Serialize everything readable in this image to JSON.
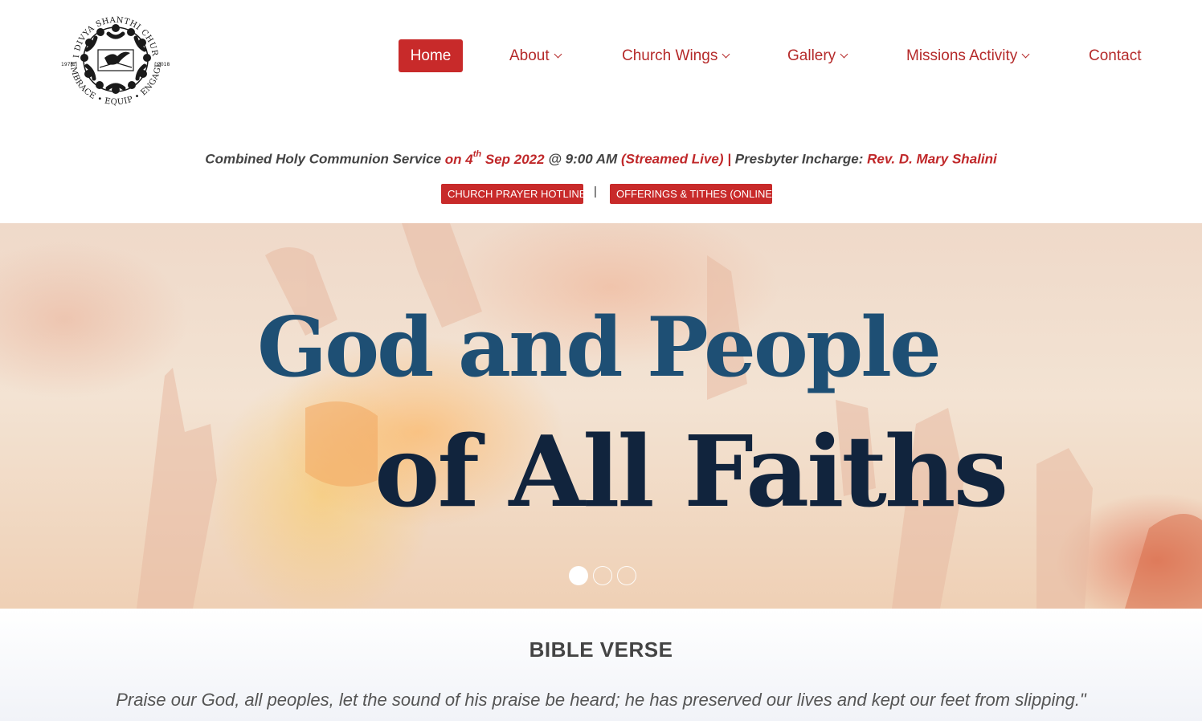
{
  "logo": {
    "ring_text_top": "CSI DIVYA SHANTHI CHURCH",
    "ring_text_bottom": "EMBRACE • EQUIP • ENGAGE",
    "year_left": "1978",
    "year_right": "2018",
    "icon": "dove-bible-emblem"
  },
  "nav": {
    "home": "Home",
    "about": "About",
    "church_wings": "Church Wings",
    "gallery": "Gallery",
    "missions": "Missions Activity",
    "contact": "Contact",
    "active": "Home"
  },
  "announcement": {
    "service": "Combined Holy Communion Service",
    "on_prefix": "on 4",
    "date_sup": "th",
    "date_suffix": "Sep 2022",
    "time": "@ 9:00 AM",
    "streamed": "(Streamed Live)",
    "divider": "|",
    "presbyter_label": "Presbyter Incharge:",
    "presbyter_name": "Rev. D. Mary Shalini"
  },
  "quick_links": {
    "prayer_hotline": "CHURCH PRAYER HOTLINE",
    "separator": "|",
    "offerings": "OFFERINGS & TITHES (ONLINE)"
  },
  "hero": {
    "line1": "God and People",
    "line2": "of All  Faiths",
    "slides": 3,
    "active_slide": 1
  },
  "bible_verse": {
    "title": "BIBLE VERSE",
    "text": "Praise our God, all peoples, let the sound of his praise be heard; he has preserved our lives and kept our feet from slipping.\""
  },
  "colors": {
    "accent": "#c82a2a",
    "nav_text": "#b52a2a",
    "hero_line1": "#1e4f74",
    "hero_line2": "#11243d"
  }
}
